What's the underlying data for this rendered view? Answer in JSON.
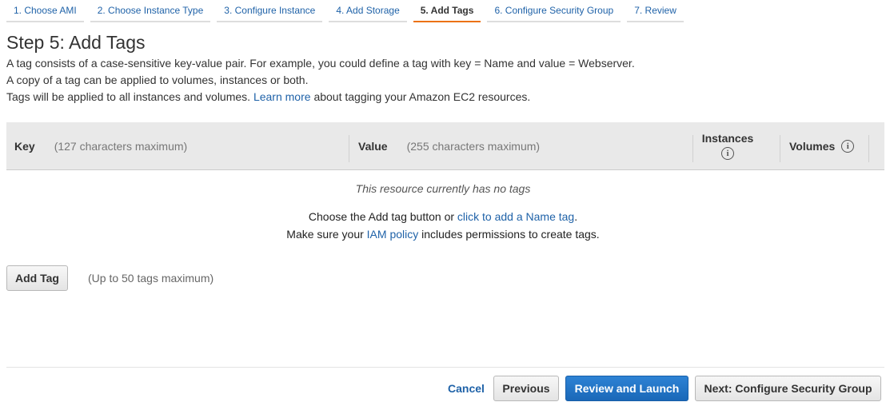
{
  "wizard": {
    "steps": [
      {
        "label": "1. Choose AMI"
      },
      {
        "label": "2. Choose Instance Type"
      },
      {
        "label": "3. Configure Instance"
      },
      {
        "label": "4. Add Storage"
      },
      {
        "label": "5. Add Tags"
      },
      {
        "label": "6. Configure Security Group"
      },
      {
        "label": "7. Review"
      }
    ],
    "active_step": 4
  },
  "page": {
    "title": "Step 5: Add Tags",
    "desc_line1": "A tag consists of a case-sensitive key-value pair. For example, you could define a tag with key = Name and value = Webserver.",
    "desc_line2": "A copy of a tag can be applied to volumes, instances or both.",
    "desc_line3_prefix": "Tags will be applied to all instances and volumes.",
    "desc_line3_link": "Learn more",
    "desc_line3_suffix": "about tagging your Amazon EC2 resources."
  },
  "table": {
    "key_label": "Key",
    "key_hint": "(127 characters maximum)",
    "value_label": "Value",
    "value_hint": "(255 characters maximum)",
    "instances_label": "Instances",
    "volumes_label": "Volumes",
    "info_glyph": "i",
    "info_icon": "info-circle-icon",
    "empty_message": "This resource currently has no tags"
  },
  "help": {
    "line1_prefix": "Choose the Add tag button or",
    "line1_link": "click to add a Name tag",
    "line1_suffix": ".",
    "line2_prefix": "Make sure your",
    "line2_link": "IAM policy",
    "line2_suffix": "includes permissions to create tags."
  },
  "actions": {
    "add_tag_label": "Add Tag",
    "add_tag_note": "(Up to 50 tags maximum)",
    "cancel_label": "Cancel",
    "previous_label": "Previous",
    "review_launch_label": "Review and Launch",
    "next_label": "Next: Configure Security Group"
  },
  "colors": {
    "link": "#1f62a8",
    "active_tab_accent": "#ec7211",
    "primary_button": "#1a68b8",
    "header_bg": "#e9e9e9"
  }
}
